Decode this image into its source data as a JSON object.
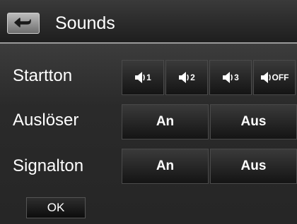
{
  "header": {
    "title": "Sounds",
    "back_icon": "back-arrow-icon"
  },
  "rows": {
    "startton": {
      "label": "Startton",
      "options": [
        {
          "icon": "speaker-icon",
          "text": "1"
        },
        {
          "icon": "speaker-icon",
          "text": "2"
        },
        {
          "icon": "speaker-icon",
          "text": "3"
        },
        {
          "icon": "speaker-icon",
          "text": "OFF"
        }
      ]
    },
    "ausloeser": {
      "label": "Auslöser",
      "on": "An",
      "off": "Aus"
    },
    "signalton": {
      "label": "Signalton",
      "on": "An",
      "off": "Aus"
    }
  },
  "footer": {
    "ok_label": "OK"
  }
}
